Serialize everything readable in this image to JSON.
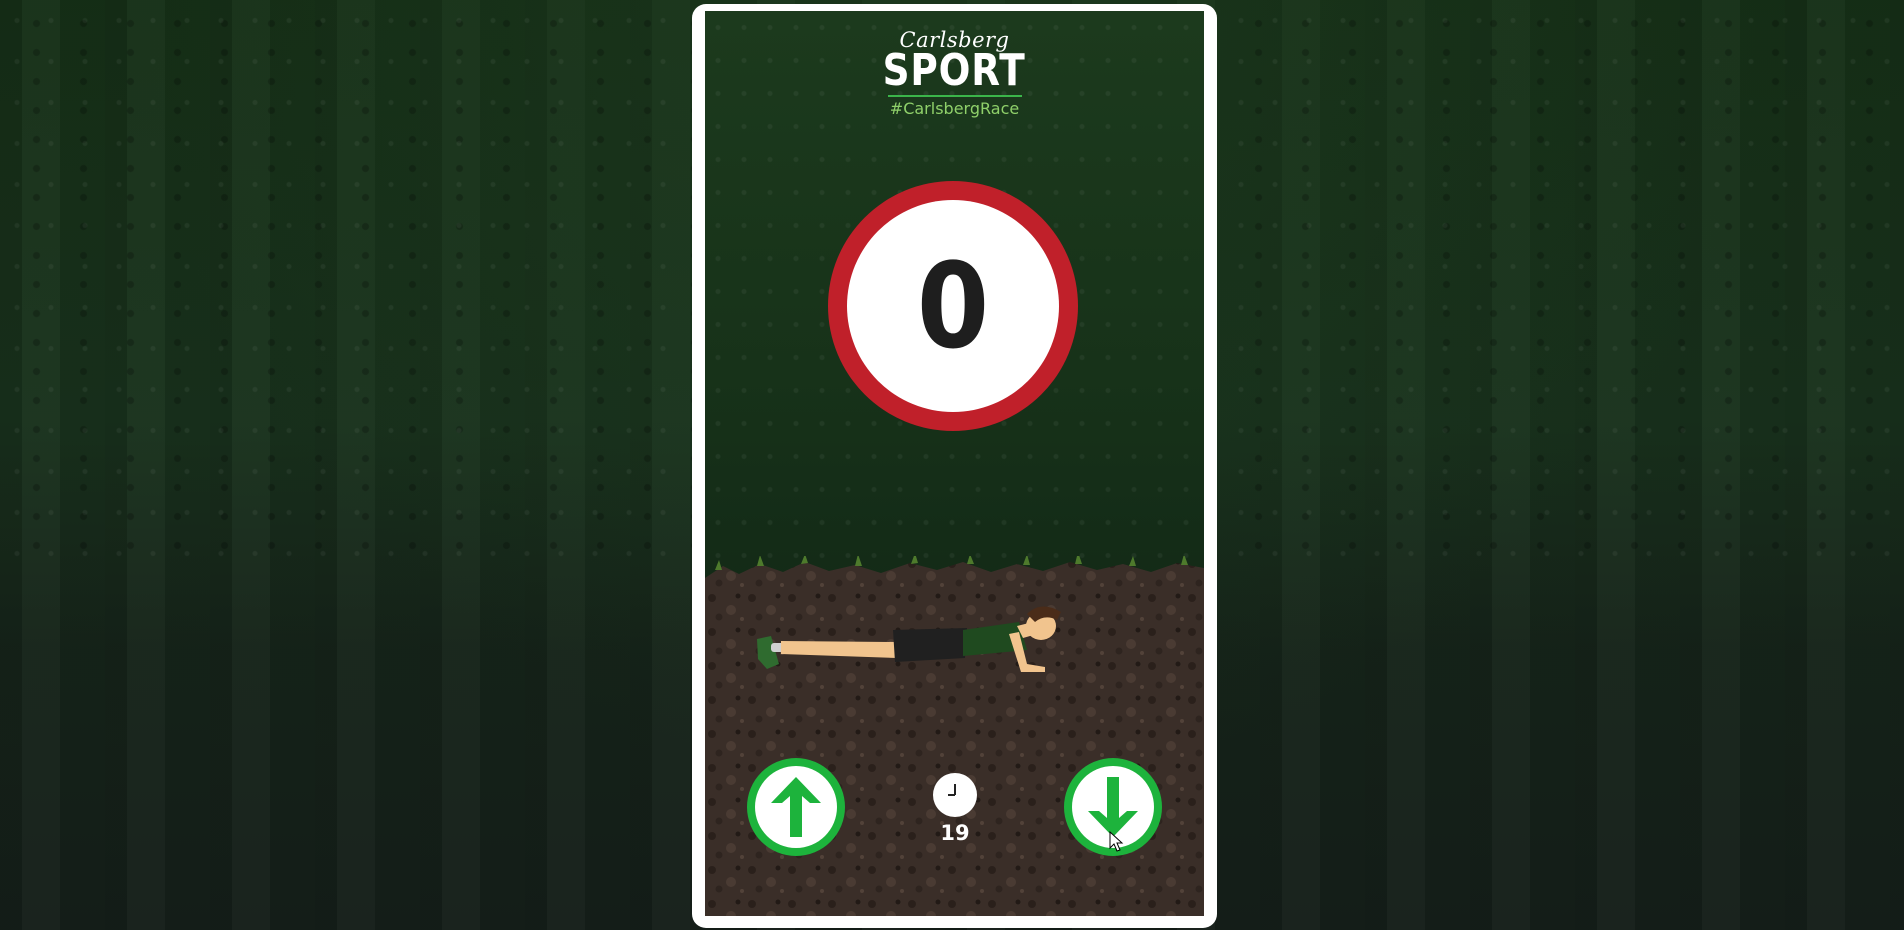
{
  "logo": {
    "brand": "Carlsberg",
    "title": "SPORT",
    "hashtag": "#CarlsbergRace"
  },
  "game": {
    "score": "0",
    "timer": "19"
  },
  "controls": {
    "up_icon": "arrow-up-icon",
    "down_icon": "arrow-down-icon",
    "timer_icon": "clock-icon"
  },
  "colors": {
    "ring": "#c0202a",
    "button": "#1db33c",
    "arrow": "#1db33c",
    "hashtag": "#8fd06a"
  }
}
